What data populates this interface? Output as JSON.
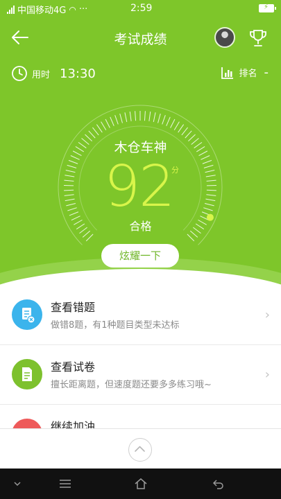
{
  "status_bar": {
    "carrier": "中国移动4G",
    "dots": "···",
    "time": "2:59"
  },
  "header": {
    "title": "考试成绩"
  },
  "stats": {
    "time_label": "用时",
    "time_value": "13:30",
    "rank_label": "排名",
    "rank_value": "-"
  },
  "result": {
    "name": "木仓车神",
    "score": "92",
    "score_unit": "分",
    "status": "合格",
    "share_button": "炫耀一下"
  },
  "list": [
    {
      "title": "查看错题",
      "subtitle": "做错8题，有1种题目类型未达标",
      "icon": "wrong-questions-icon",
      "color": "#3bb4ec"
    },
    {
      "title": "查看试卷",
      "subtitle": "擅长距离题，但速度题还要多多练习哦~",
      "icon": "exam-paper-icon",
      "color": "#7dc12d"
    },
    {
      "title": "继续加油",
      "subtitle": "",
      "icon": "gift-icon",
      "color": "#ee5a5a"
    }
  ],
  "colors": {
    "header_green": "#7ec62a",
    "score_yellow": "#d8f54a"
  }
}
